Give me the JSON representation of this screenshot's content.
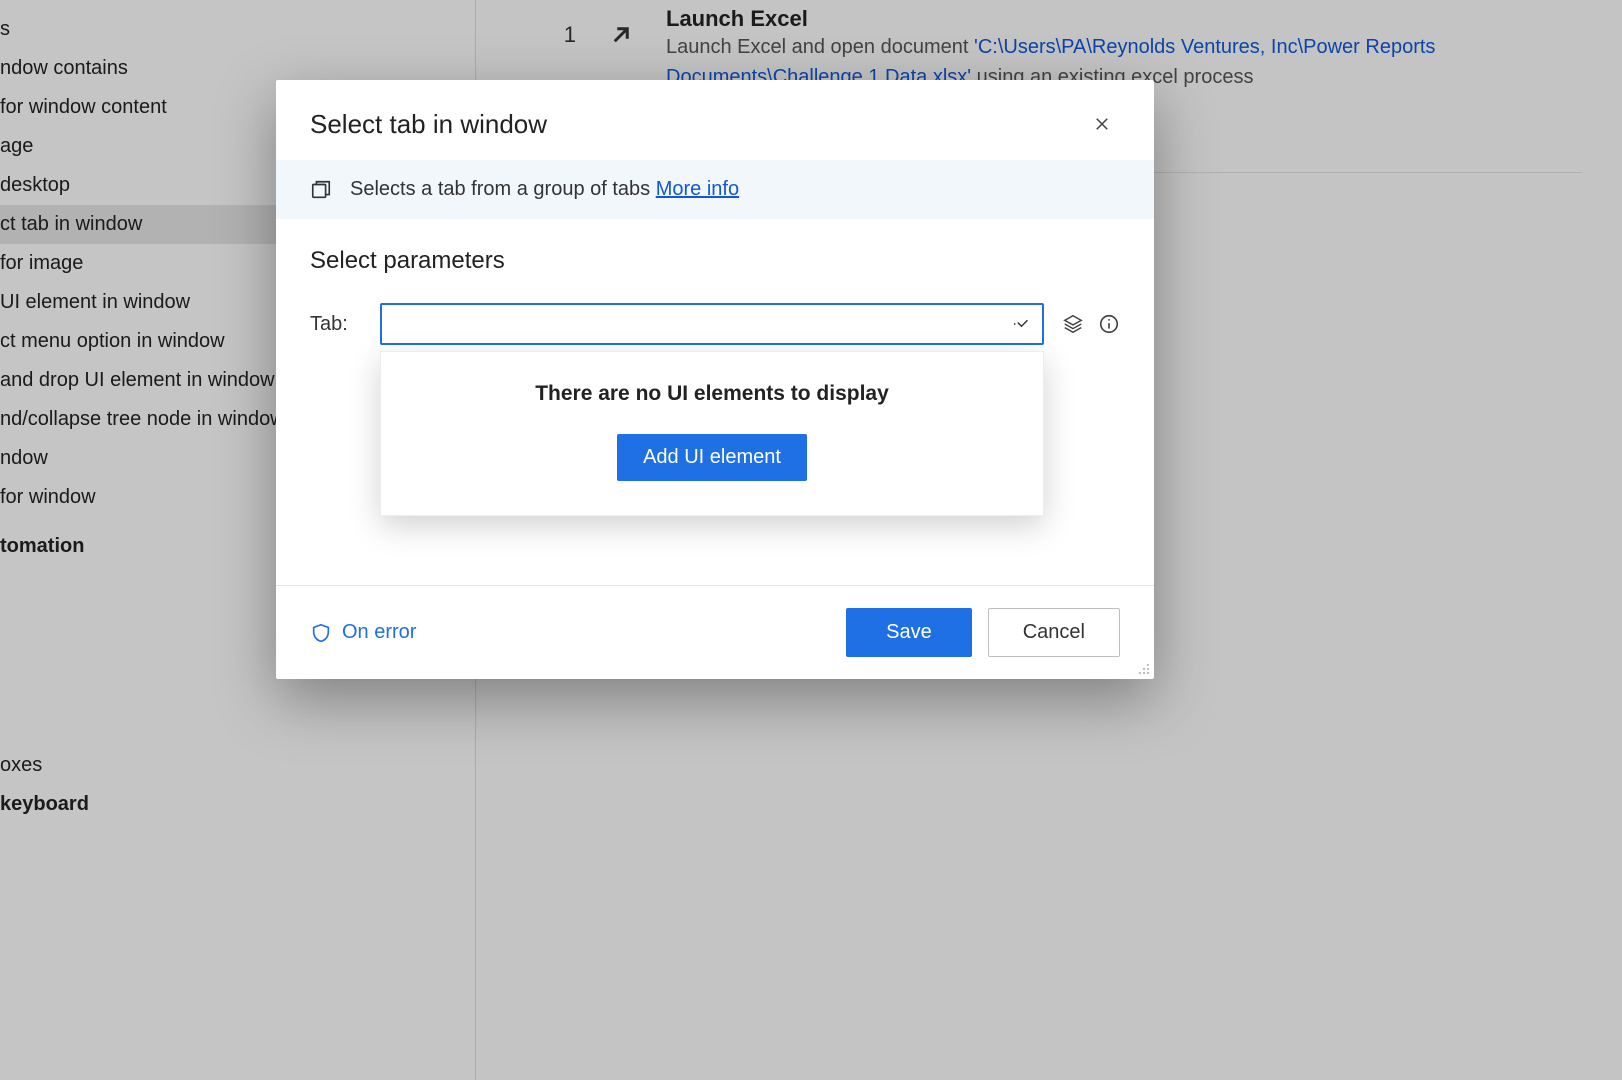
{
  "sidebar": {
    "items": [
      {
        "label": "s"
      },
      {
        "label": "ndow contains"
      },
      {
        "label": "for window content"
      },
      {
        "label": "age"
      },
      {
        "label": "desktop"
      },
      {
        "label": "ct tab in window",
        "selected": true
      },
      {
        "label": "for image"
      },
      {
        "label": "UI element in window"
      },
      {
        "label": "ct menu option in window"
      },
      {
        "label": "and drop UI element in window"
      },
      {
        "label": "nd/collapse tree node in window"
      },
      {
        "label": "ndow"
      },
      {
        "label": "for window"
      }
    ],
    "section_automation": "tomation",
    "items2": [
      {
        "label": "oxes"
      },
      {
        "label": "keyboard",
        "bold": true
      }
    ]
  },
  "main": {
    "step_number": "1",
    "step_title": "Launch Excel",
    "step_desc_prefix": "Launch Excel and open document ",
    "step_path": "'C:\\Users\\PA\\Reynolds Ventures, Inc\\Power Reports Documents\\Challenge 1 Data.xlsx'",
    "step_desc_suffix": " using an existing excel process"
  },
  "modal": {
    "title": "Select tab in window",
    "info_text": "Selects a tab from a group of tabs ",
    "more_info": "More info",
    "section_title": "Select parameters",
    "param_label": "Tab:",
    "tab_value": "",
    "dropdown_empty": "There are no UI elements to display",
    "add_ui_element": "Add UI element",
    "on_error": "On error",
    "save": "Save",
    "cancel": "Cancel"
  }
}
